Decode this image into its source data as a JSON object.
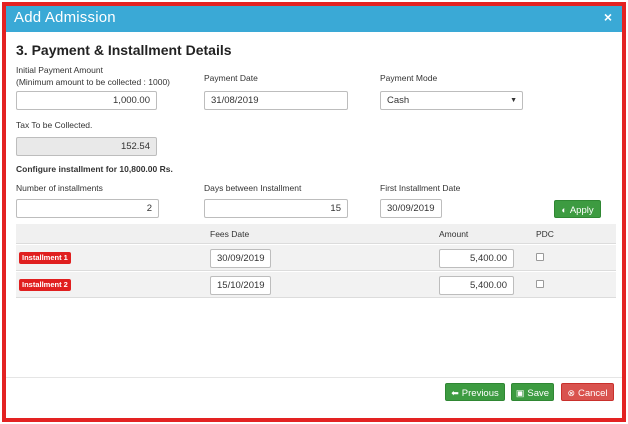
{
  "dialog": {
    "title": "Add Admission",
    "close_glyph": "×"
  },
  "section": {
    "title": "3. Payment & Installment Details"
  },
  "payment": {
    "initial_amount_label": "Initial Payment Amount",
    "initial_amount_note": "(Minimum amount to be collected : 1000)",
    "initial_amount_value": "1,000.00",
    "payment_date_label": "Payment Date",
    "payment_date_value": "31/08/2019",
    "payment_mode_label": "Payment Mode",
    "payment_mode_value": "Cash",
    "tax_label": "Tax To be Collected.",
    "tax_value": "152.54"
  },
  "installment_config": {
    "heading": "Configure installment for 10,800.00 Rs.",
    "count_label": "Number of installments",
    "count_value": "2",
    "days_label": "Days between Installment",
    "days_value": "15",
    "first_date_label": "First Installment Date",
    "first_date_value": "30/09/2019",
    "apply_label": "Apply"
  },
  "table": {
    "headers": {
      "fees_date": "Fees Date",
      "amount": "Amount",
      "pdc": "PDC"
    },
    "rows": [
      {
        "label": "Installment 1",
        "date": "30/09/2019",
        "amount": "5,400.00",
        "pdc": false
      },
      {
        "label": "Installment 2",
        "date": "15/10/2019",
        "amount": "5,400.00",
        "pdc": false
      }
    ]
  },
  "footer": {
    "previous_label": "Previous",
    "save_label": "Save",
    "cancel_label": "Cancel"
  },
  "colors": {
    "title_bar": "#3aa9d6",
    "frame_border": "#e32222",
    "green_button": "#3d9b41",
    "red_button": "#d9534f",
    "badge": "#e01f1f"
  },
  "icons": {
    "apply": "half-circle-icon",
    "previous": "arrow-left-icon",
    "save": "floppy-disk-icon",
    "cancel": "times-circle-icon",
    "close": "close-icon",
    "select_caret": "caret-down-icon"
  }
}
